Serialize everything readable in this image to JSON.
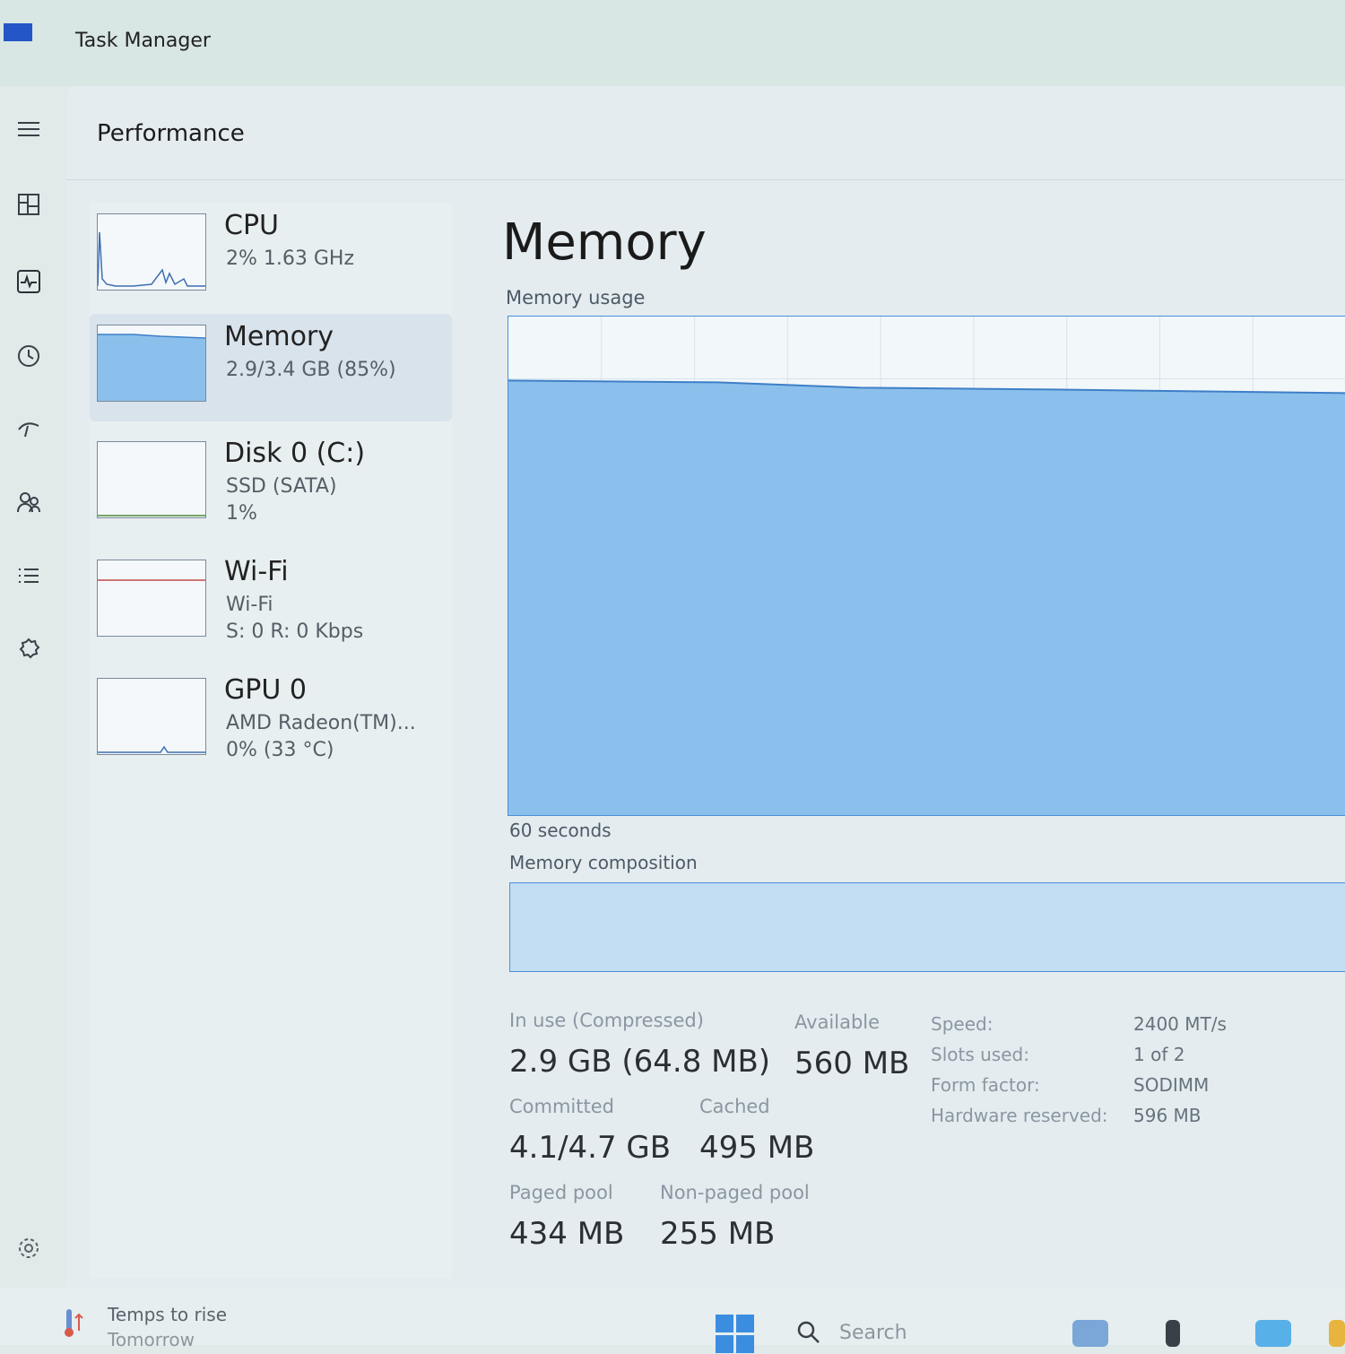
{
  "window": {
    "title": "Task Manager"
  },
  "page": {
    "title": "Performance"
  },
  "devices": [
    {
      "name": "CPU",
      "line1": "2% 1.63 GHz",
      "line2": ""
    },
    {
      "name": "Memory",
      "line1": "2.9/3.4 GB (85%)",
      "line2": ""
    },
    {
      "name": "Disk 0 (C:)",
      "line1": "SSD (SATA)",
      "line2": "1%"
    },
    {
      "name": "Wi-Fi",
      "line1": "Wi-Fi",
      "line2": "S: 0 R: 0 Kbps"
    },
    {
      "name": "GPU 0",
      "line1": "AMD Radeon(TM)...",
      "line2": "0% (33 °C)"
    }
  ],
  "memory": {
    "title": "Memory",
    "usage_label": "Memory usage",
    "seconds_label": "60 seconds",
    "composition_label": "Memory composition",
    "usage_percent": 85,
    "stats": {
      "in_use_label": "In use (Compressed)",
      "in_use_value": "2.9 GB (64.8 MB)",
      "available_label": "Available",
      "available_value": "560 MB",
      "committed_label": "Committed",
      "committed_value": "4.1/4.7 GB",
      "cached_label": "Cached",
      "cached_value": "495 MB",
      "paged_label": "Paged pool",
      "paged_value": "434 MB",
      "nonpaged_label": "Non-paged pool",
      "nonpaged_value": "255 MB"
    },
    "specs": [
      {
        "label": "Speed:",
        "value": "2400 MT/s"
      },
      {
        "label": "Slots used:",
        "value": "1 of 2"
      },
      {
        "label": "Form factor:",
        "value": "SODIMM"
      },
      {
        "label": "Hardware reserved:",
        "value": "596 MB"
      }
    ]
  },
  "taskbar": {
    "weather_line1": "Temps to rise",
    "weather_line2": "Tomorrow",
    "search_placeholder": "Search"
  },
  "colors": {
    "accent": "#4a90d9",
    "memory_fill": "#8cc0ec",
    "graph_bg": "#f2f7fa"
  },
  "icons": {
    "nav": [
      "menu-icon",
      "processes-icon",
      "performance-icon",
      "app-history-icon",
      "startup-apps-icon",
      "users-icon",
      "details-icon",
      "services-icon",
      "settings-icon"
    ]
  }
}
